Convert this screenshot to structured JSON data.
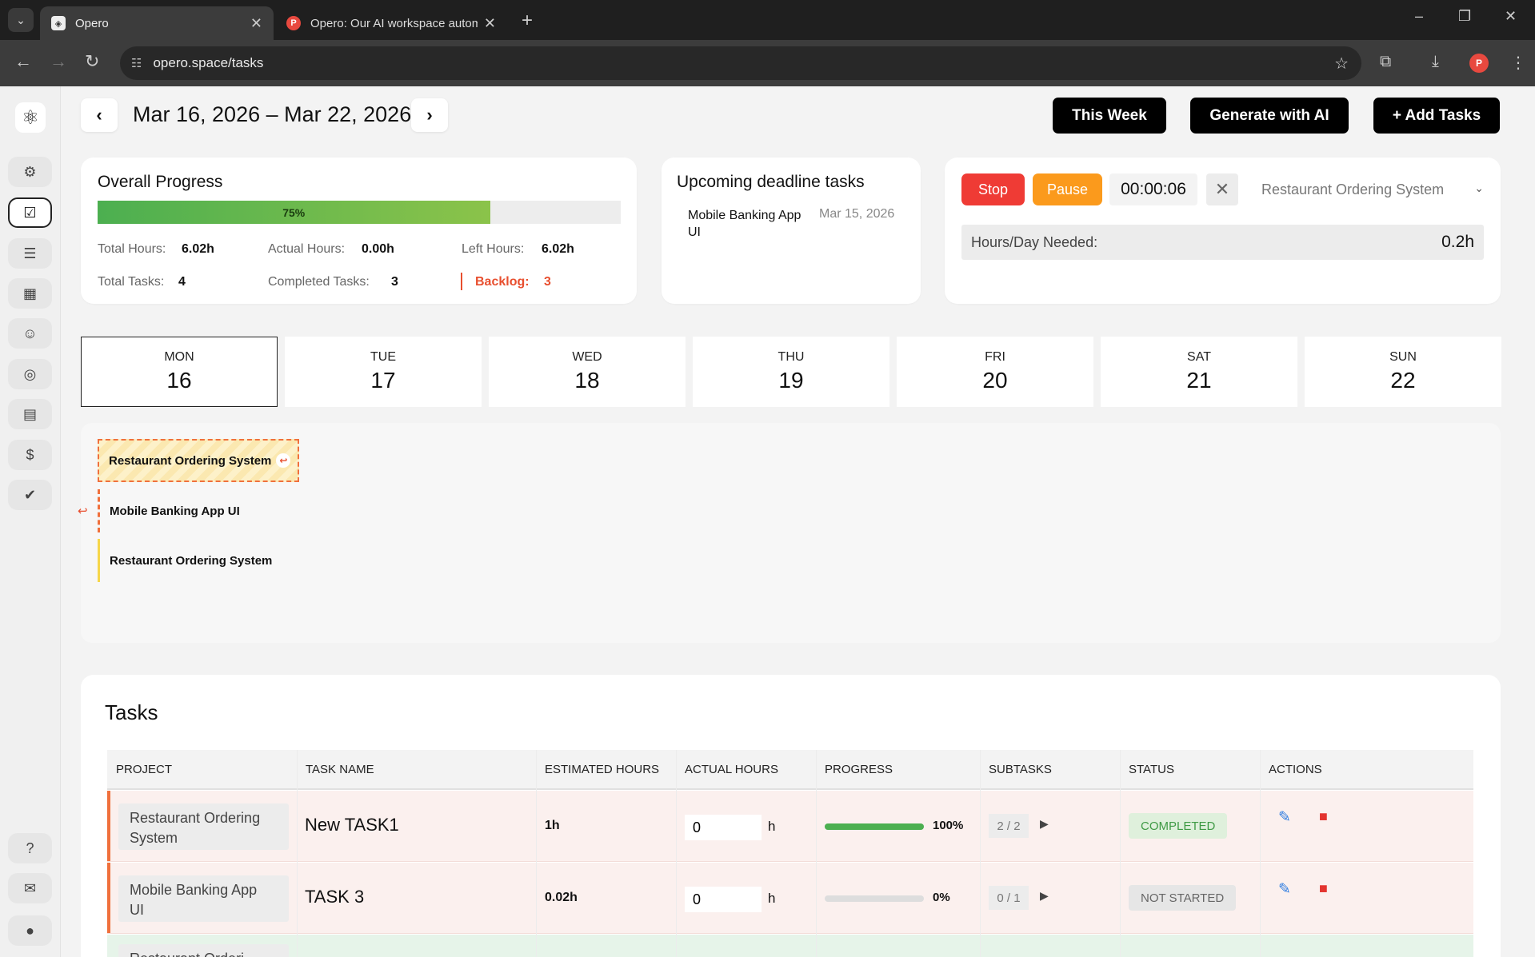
{
  "browser": {
    "tabs": [
      {
        "title": "Opero"
      },
      {
        "title": "Opero: Our AI workspace autom"
      }
    ],
    "url": "opero.space/tasks",
    "profile_initial": "P"
  },
  "header": {
    "range": "Mar 16, 2026 – Mar 22, 2026",
    "this_week": "This Week",
    "generate_ai": "Generate with AI",
    "add_tasks": "+ Add Tasks"
  },
  "overall": {
    "title": "Overall Progress",
    "percent": 75,
    "percent_label": "75%",
    "total_hours_label": "Total Hours:",
    "total_hours": "6.02h",
    "actual_hours_label": "Actual Hours:",
    "actual_hours": "0.00h",
    "left_hours_label": "Left Hours:",
    "left_hours": "6.02h",
    "total_tasks_label": "Total Tasks:",
    "total_tasks": "4",
    "completed_tasks_label": "Completed Tasks:",
    "completed_tasks": "3",
    "backlog_label": "Backlog:",
    "backlog": "3"
  },
  "upcoming": {
    "title": "Upcoming deadline tasks",
    "items": [
      {
        "name_line1": "Mobile Banking App",
        "name_line2": "UI",
        "date": "Mar 15, 2026"
      }
    ]
  },
  "timer": {
    "stop": "Stop",
    "pause": "Pause",
    "time": "00:00:06",
    "project": "Restaurant Ordering System",
    "hours_needed_label": "Hours/Day Needed:",
    "hours_needed": "0.2h"
  },
  "days": [
    {
      "name": "MON",
      "date": "16"
    },
    {
      "name": "TUE",
      "date": "17"
    },
    {
      "name": "WED",
      "date": "18"
    },
    {
      "name": "THU",
      "date": "19"
    },
    {
      "name": "FRI",
      "date": "20"
    },
    {
      "name": "SAT",
      "date": "21"
    },
    {
      "name": "SUN",
      "date": "22"
    }
  ],
  "schedule": [
    {
      "label": "Restaurant Ordering System"
    },
    {
      "label": "Mobile Banking App UI"
    },
    {
      "label": "Restaurant Ordering System"
    }
  ],
  "tasks": {
    "title": "Tasks",
    "columns": [
      "PROJECT",
      "TASK NAME",
      "ESTIMATED HOURS",
      "ACTUAL HOURS",
      "PROGRESS",
      "SUBTASKS",
      "STATUS",
      "ACTIONS"
    ],
    "rows": [
      {
        "project_line1": "Restaurant Ordering",
        "project_line2": "System",
        "name": "New TASK1",
        "estimated": "1h",
        "actual": "0",
        "unit": "h",
        "progress": 100,
        "progress_label": "100%",
        "subtasks": "2 / 2",
        "status": "COMPLETED"
      },
      {
        "project_line1": "Mobile Banking App",
        "project_line2": "UI",
        "name": "TASK 3",
        "estimated": "0.02h",
        "actual": "0",
        "unit": "h",
        "progress": 0,
        "progress_label": "0%",
        "subtasks": "0 / 1",
        "status": "NOT STARTED"
      },
      {
        "project_line1": "Restaurant Orderi",
        "project_line2": "",
        "name": "",
        "estimated": "",
        "actual": "",
        "unit": "",
        "progress": 0,
        "progress_label": "",
        "subtasks": "",
        "status": ""
      }
    ]
  },
  "colors": {
    "accent_orange": "#f0703c",
    "stop_red": "#ef3b35",
    "pause_orange": "#fb9a1c",
    "progress_green": "#4caf50",
    "backlog_red": "#e84f2f"
  }
}
